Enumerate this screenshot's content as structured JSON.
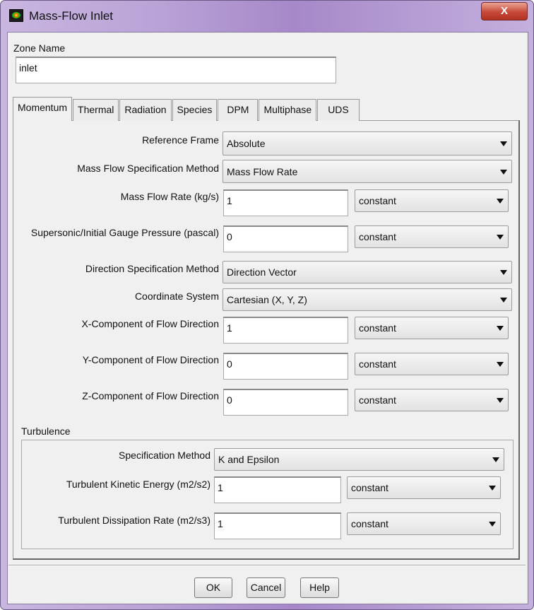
{
  "window": {
    "title": "Mass-Flow Inlet",
    "close": "X"
  },
  "zone": {
    "label": "Zone Name",
    "value": "inlet"
  },
  "tabs": [
    "Momentum",
    "Thermal",
    "Radiation",
    "Species",
    "DPM",
    "Multiphase",
    "UDS"
  ],
  "momentum": {
    "reference_frame": {
      "label": "Reference Frame",
      "value": "Absolute"
    },
    "mass_flow_spec": {
      "label": "Mass Flow Specification Method",
      "value": "Mass Flow Rate"
    },
    "mass_flow_rate": {
      "label": "Mass Flow Rate (kg/s)",
      "value": "1",
      "profile": "constant"
    },
    "gauge_pressure": {
      "label": "Supersonic/Initial Gauge Pressure (pascal)",
      "value": "0",
      "profile": "constant"
    },
    "direction_spec": {
      "label": "Direction Specification Method",
      "value": "Direction Vector"
    },
    "coordinate_system": {
      "label": "Coordinate System",
      "value": "Cartesian (X, Y, Z)"
    },
    "x_component": {
      "label": "X-Component of Flow Direction",
      "value": "1",
      "profile": "constant"
    },
    "y_component": {
      "label": "Y-Component of Flow Direction",
      "value": "0",
      "profile": "constant"
    },
    "z_component": {
      "label": "Z-Component of Flow Direction",
      "value": "0",
      "profile": "constant"
    }
  },
  "turbulence": {
    "label": "Turbulence",
    "spec_method": {
      "label": "Specification Method",
      "value": "K and Epsilon"
    },
    "tke": {
      "label": "Turbulent Kinetic Energy (m2/s2)",
      "value": "1",
      "profile": "constant"
    },
    "tdr": {
      "label": "Turbulent Dissipation Rate (m2/s3)",
      "value": "1",
      "profile": "constant"
    }
  },
  "buttons": {
    "ok": "OK",
    "cancel": "Cancel",
    "help": "Help"
  }
}
